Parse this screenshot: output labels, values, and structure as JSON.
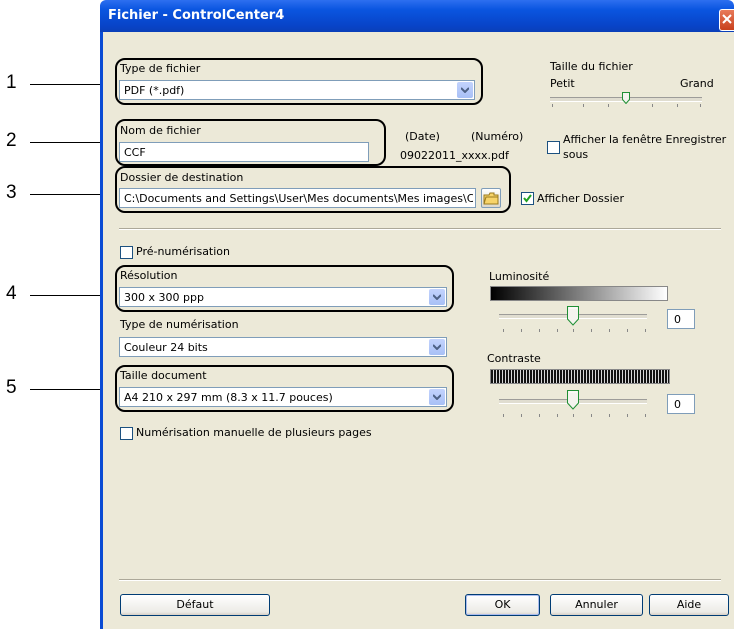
{
  "window": {
    "title": "Fichier - ControlCenter4"
  },
  "callouts": [
    "1",
    "2",
    "3",
    "4",
    "5"
  ],
  "file_type": {
    "label": "Type de fichier",
    "value": "PDF (*.pdf)"
  },
  "file_size": {
    "label": "Taille du fichier",
    "min_label": "Petit",
    "max_label": "Grand"
  },
  "file_name": {
    "label": "Nom de fichier",
    "value": "CCF",
    "date_label": "(Date)",
    "number_label": "(Numéro)",
    "example": "09022011_xxxx.pdf"
  },
  "show_save_as": {
    "label_line1": "Afficher la fenêtre Enregistrer",
    "label_line2": "sous",
    "checked": false
  },
  "destination": {
    "label": "Dossier de destination",
    "value": "C:\\Documents and Settings\\User\\Mes documents\\Mes images\\C"
  },
  "show_folder": {
    "label": "Afficher Dossier",
    "checked": true
  },
  "prescan": {
    "label": "Pré-numérisation",
    "checked": false
  },
  "resolution": {
    "label": "Résolution",
    "value": "300 x 300 ppp"
  },
  "scan_type": {
    "label": "Type de numérisation",
    "value": "Couleur 24 bits"
  },
  "doc_size": {
    "label": "Taille document",
    "value": "A4 210 x 297 mm (8.3 x 11.7 pouces)"
  },
  "manual_multi": {
    "label": "Numérisation manuelle de plusieurs pages",
    "checked": false
  },
  "brightness": {
    "label": "Luminosité",
    "value": "0"
  },
  "contrast": {
    "label": "Contraste",
    "value": "0"
  },
  "buttons": {
    "default": "Défaut",
    "ok": "OK",
    "cancel": "Annuler",
    "help": "Aide"
  }
}
